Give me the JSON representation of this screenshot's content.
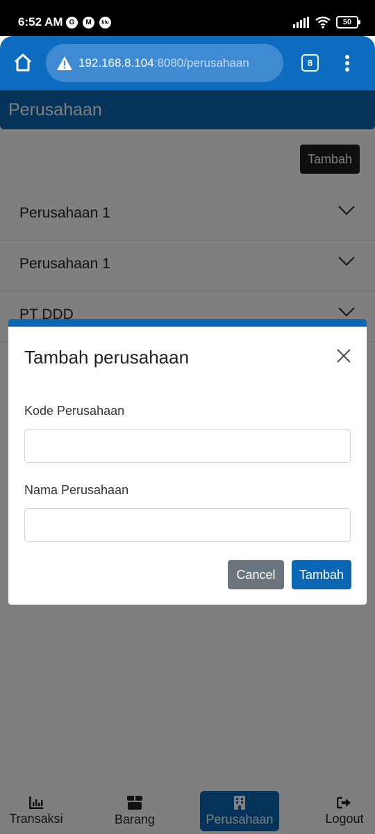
{
  "status_bar": {
    "time": "6:52 AM",
    "notification_icons": [
      "google-icon",
      "gmail-icon",
      "blu-app-icon"
    ],
    "blu_label": "blu",
    "battery": "50"
  },
  "browser": {
    "url_host": "192.168.8.104",
    "url_rest": ":8080/perusahaan",
    "tab_count": "8"
  },
  "app": {
    "title": "Perusahaan",
    "add_button": "Tambah",
    "companies": [
      {
        "name": "Perusahaan 1"
      },
      {
        "name": "Perusahaan 1"
      },
      {
        "name": "PT DDD"
      }
    ]
  },
  "modal": {
    "title": "Tambah perusahaan",
    "field_code_label": "Kode Perusahaan",
    "field_code_value": "",
    "field_name_label": "Nama Perusahaan",
    "field_name_value": "",
    "cancel_label": "Cancel",
    "submit_label": "Tambah"
  },
  "bottom_nav": {
    "items": [
      {
        "label": "Transaksi",
        "icon": "chart-icon"
      },
      {
        "label": "Barang",
        "icon": "box-icon"
      },
      {
        "label": "Perusahaan",
        "icon": "building-icon",
        "active": true
      },
      {
        "label": "Logout",
        "icon": "logout-icon"
      }
    ]
  },
  "colors": {
    "primary": "#0b66b3",
    "browser_bar": "#0d6cc0",
    "dark_button": "#1f1f1f",
    "secondary_button": "#6c757d"
  }
}
